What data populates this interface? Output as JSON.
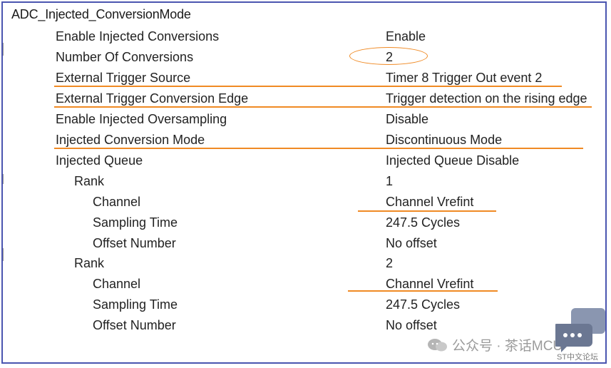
{
  "title": "ADC_Injected_ConversionMode",
  "rows": [
    {
      "label": "Enable Injected Conversions",
      "value": "Enable"
    },
    {
      "label": "Number Of Conversions",
      "value": "2"
    },
    {
      "label": "External Trigger Source",
      "value": "Timer 8 Trigger Out event 2"
    },
    {
      "label": "External Trigger Conversion Edge",
      "value": "Trigger detection on the rising edge"
    },
    {
      "label": "Enable Injected Oversampling",
      "value": "Disable"
    },
    {
      "label": "Injected Conversion Mode",
      "value": "Discontinuous Mode"
    },
    {
      "label": "Injected Queue",
      "value": "Injected Queue Disable"
    },
    {
      "label": "Rank",
      "value": "1"
    },
    {
      "label": "Channel",
      "value": "Channel Vrefint"
    },
    {
      "label": "Sampling Time",
      "value": "247.5 Cycles"
    },
    {
      "label": "Offset Number",
      "value": "No offset"
    },
    {
      "label": "Rank",
      "value": "2"
    },
    {
      "label": "Channel",
      "value": "Channel Vrefint"
    },
    {
      "label": "Sampling Time",
      "value": "247.5 Cycles"
    },
    {
      "label": "Offset Number",
      "value": "No offset"
    }
  ],
  "watermark": {
    "text": "公众号 · 茶话MCU",
    "badge": "ST中文论坛"
  },
  "colors": {
    "annotation": "#f08a24",
    "border": "#4a55b0"
  }
}
